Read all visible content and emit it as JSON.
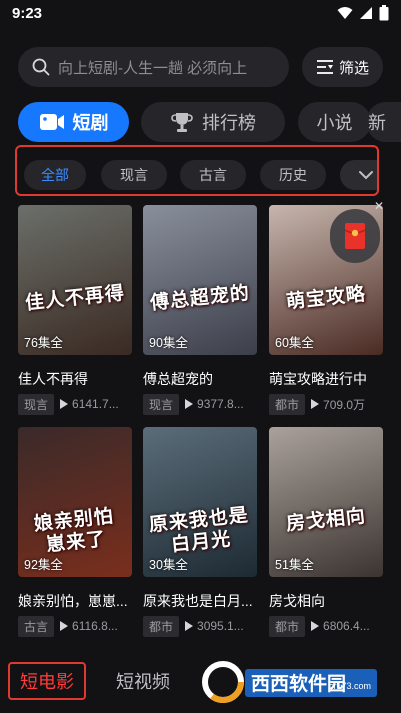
{
  "status": {
    "time": "9:23"
  },
  "search": {
    "placeholder": "向上短剧-人生一趟 必须向上"
  },
  "filter": {
    "label": "筛选"
  },
  "tabs": [
    {
      "label": "短剧",
      "icon": "video-camera-icon",
      "active": true
    },
    {
      "label": "排行榜",
      "icon": "trophy-icon",
      "active": false
    },
    {
      "label": "小说",
      "active": false
    },
    {
      "label": "新",
      "active": false
    }
  ],
  "subtabs": [
    {
      "label": "全部",
      "selected": true
    },
    {
      "label": "现言",
      "selected": false
    },
    {
      "label": "古言",
      "selected": false
    },
    {
      "label": "历史",
      "selected": false
    }
  ],
  "cards": [
    {
      "title": "佳人不再得",
      "episodes": "76集全",
      "genre": "现言",
      "plays": "6141.7...",
      "art": "佳人不再得",
      "colors": [
        "#6b6f6a",
        "#3a2a22"
      ]
    },
    {
      "title": "傅总超宠的",
      "episodes": "90集全",
      "genre": "现言",
      "plays": "9377.8...",
      "art": "傅总超宠的",
      "colors": [
        "#8a8f9c",
        "#3c3f4a"
      ]
    },
    {
      "title": "萌宝攻略进行中",
      "episodes": "60集全",
      "genre": "都市",
      "plays": "709.0万",
      "art": "萌宝攻略",
      "colors": [
        "#c7b6ad",
        "#4a2b24"
      ]
    },
    {
      "title": "娘亲别怕，崽崽...",
      "episodes": "92集全",
      "genre": "古言",
      "plays": "6116.8...",
      "art": "娘亲别怕 崽来了",
      "colors": [
        "#3a2a2a",
        "#7a2e1c"
      ]
    },
    {
      "title": "原来我也是白月...",
      "episodes": "30集全",
      "genre": "都市",
      "plays": "3095.1...",
      "art": "原来我也是白月光",
      "colors": [
        "#5b6d7a",
        "#1d2a33"
      ]
    },
    {
      "title": "房戈相向",
      "episodes": "51集全",
      "genre": "都市",
      "plays": "6806.4...",
      "art": "房戈相向",
      "colors": [
        "#a9a19a",
        "#3b3431"
      ]
    }
  ],
  "bottom_nav": [
    {
      "label": "短电影",
      "active": true
    },
    {
      "label": "短视频",
      "active": false
    }
  ],
  "watermark": {
    "brand": "西西软件园",
    "site": "cr173.com"
  },
  "accent": "#1677ff",
  "highlight": "#e0392f"
}
